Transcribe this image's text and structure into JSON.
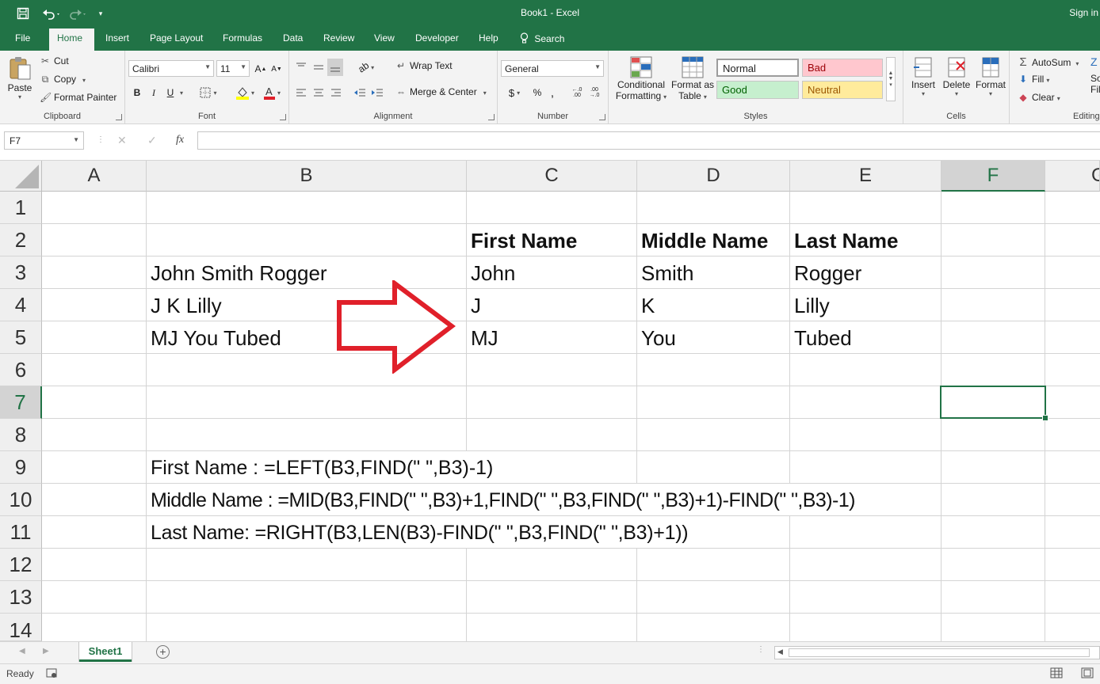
{
  "window": {
    "title": "Book1  -  Excel",
    "signin": "Sign in"
  },
  "qat": {
    "save_icon": "save-icon",
    "undo_icon": "undo-icon",
    "redo_icon": "redo-icon",
    "customize_icon": "customize-icon"
  },
  "tabs": [
    {
      "label": "File"
    },
    {
      "label": "Home"
    },
    {
      "label": "Insert"
    },
    {
      "label": "Page Layout"
    },
    {
      "label": "Formulas"
    },
    {
      "label": "Data"
    },
    {
      "label": "Review"
    },
    {
      "label": "View"
    },
    {
      "label": "Developer"
    },
    {
      "label": "Help"
    },
    {
      "label": "Search"
    }
  ],
  "ribbon": {
    "clipboard": {
      "label": "Clipboard",
      "paste": "Paste",
      "cut": "Cut",
      "copy": "Copy",
      "format_painter": "Format Painter"
    },
    "font": {
      "label": "Font",
      "family": "Calibri",
      "size": "11",
      "bold": "B",
      "italic": "I",
      "underline": "U"
    },
    "alignment": {
      "label": "Alignment",
      "wrap_text": "Wrap Text",
      "merge_center": "Merge & Center"
    },
    "number": {
      "label": "Number",
      "format": "General",
      "currency": "$",
      "percent": "%",
      "comma": ",",
      "inc_decimal": "←.0 .00",
      "dec_decimal": ".00 →.0"
    },
    "styles": {
      "label": "Styles",
      "conditional_1": "Conditional",
      "conditional_2": "Formatting",
      "format_as_1": "Format as",
      "format_as_2": "Table",
      "normal": "Normal",
      "bad": "Bad",
      "good": "Good",
      "neutral": "Neutral",
      "bad_bg": "#ffc7ce",
      "bad_fg": "#9c0006",
      "good_bg": "#c6efce",
      "good_fg": "#006100",
      "neutral_bg": "#ffeb9c",
      "neutral_fg": "#9c5700"
    },
    "cells": {
      "label": "Cells",
      "insert": "Insert",
      "delete": "Delete",
      "format": "Format"
    },
    "editing": {
      "label": "Editing",
      "autosum": "AutoSum",
      "fill": "Fill",
      "clear": "Clear",
      "sort_1": "So",
      "sort_2": "Fil"
    }
  },
  "formula_bar": {
    "name_box": "F7",
    "fx": "fx",
    "cancel": "✕",
    "enter": "✓",
    "value": ""
  },
  "columns": [
    "A",
    "B",
    "C",
    "D",
    "E",
    "F",
    "G"
  ],
  "rows": [
    "1",
    "2",
    "3",
    "4",
    "5",
    "6",
    "7",
    "8",
    "9",
    "10",
    "11",
    "12",
    "13",
    "14"
  ],
  "selected_cell": "F7",
  "cells": {
    "C2": "First Name",
    "D2": "Middle Name",
    "E2": "Last Name",
    "B3": "John Smith Rogger",
    "C3": "John",
    "D3": "Smith",
    "E3": "Rogger",
    "B4": "J K Lilly",
    "C4": "J",
    "D4": "K",
    "E4": "Lilly",
    "B5": "MJ You Tubed",
    "C5": "MJ",
    "D5": "You",
    "E5": "Tubed",
    "B9": "First Name : =LEFT(B3,FIND(\" \",B3)-1)",
    "B10": "Middle Name : =MID(B3,FIND(\" \",B3)+1,FIND(\" \",B3,FIND(\" \",B3)+1)-FIND(\" \",B3)-1)",
    "B11": "Last Name: =RIGHT(B3,LEN(B3)-FIND(\" \",B3,FIND(\" \",B3)+1))"
  },
  "arrow": {
    "color": "#e0202a",
    "icon": "right-arrow-icon"
  },
  "sheets": [
    {
      "name": "Sheet1"
    }
  ],
  "status": {
    "ready": "Ready"
  },
  "accent": "#217346"
}
